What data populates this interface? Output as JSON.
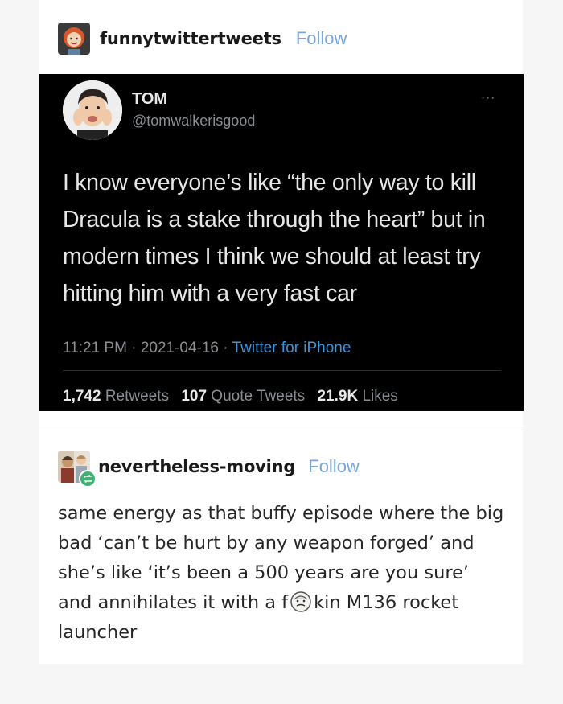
{
  "post1": {
    "username": "funnytwittertweets",
    "follow_label": "Follow",
    "avatar_icon": "user-avatar-icon"
  },
  "tweet": {
    "name": "TOM",
    "handle": "@tomwalkerisgood",
    "more": "···",
    "body": "I know everyone’s like “the only way to kill Dracula is a stake through the heart” but in modern times I think we should at least try hitting him with a very fast car",
    "time": "11:21 PM",
    "date": "2021-04-16",
    "sep": "·",
    "source": "Twitter for iPhone",
    "retweets_count": "1,742",
    "retweets_label": "Retweets",
    "quotes_count": "107",
    "quotes_label": "Quote Tweets",
    "likes_count": "21.9K",
    "likes_label": "Likes"
  },
  "post2": {
    "username": "nevertheless-moving",
    "follow_label": "Follow",
    "avatar_icon": "user-avatar-icon",
    "badge_icon": "reblog-icon",
    "body_before": "same energy as that buffy episode where the big bad ‘can’t be hurt by any weapon forged’ and she’s like ‘it’s been a 500 years are you sure’ and annihilates it with a f",
    "censor_icon": "censored-face-icon",
    "body_after": "kin M136 rocket launcher"
  },
  "colors": {
    "follow": "#7aa6d6",
    "tweet_bg": "#000000",
    "tweet_link": "#3d95d9",
    "reblog_badge": "#3cb371"
  }
}
